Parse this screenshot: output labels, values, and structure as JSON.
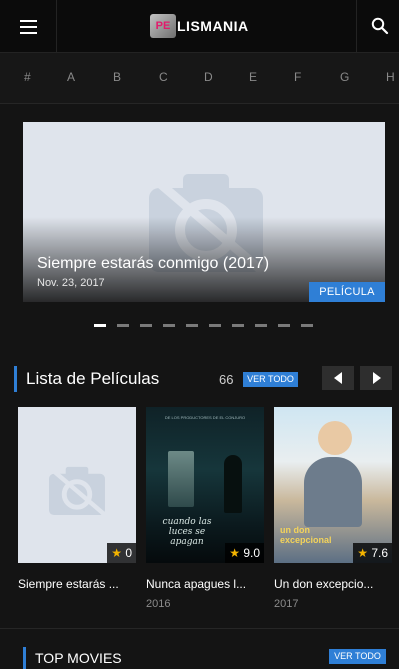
{
  "header": {
    "logo_mark": "PE",
    "logo_text": "LISMANIA",
    "menu_icon": "hamburger-menu-icon",
    "search_icon": "search-icon"
  },
  "alphabet": [
    "#",
    "A",
    "B",
    "C",
    "D",
    "E",
    "F",
    "G",
    "H"
  ],
  "slider": {
    "title": "Siempre estarás conmigo (2017)",
    "date": "Nov. 23, 2017",
    "badge": "PELÍCULA",
    "image_icon": "no-image-camera-icon",
    "dots_total": 10,
    "dots_active": 0
  },
  "movies_section": {
    "title": "Lista de Películas",
    "count": "66",
    "see_all": "VER TODO",
    "prev_icon": "chevron-left-icon",
    "next_icon": "chevron-right-icon"
  },
  "movies": [
    {
      "title": "Siempre estarás ...",
      "year": "",
      "rating": "0",
      "poster": "no-image"
    },
    {
      "title": "Nunca apagues l...",
      "year": "2016",
      "rating": "9.0",
      "poster": "dark-poster",
      "poster_text": "cuando las luces se apagan",
      "poster_top": "DE LOS PRODUCTORES DE EL CONJURO"
    },
    {
      "title": "Un don excepcio...",
      "year": "2017",
      "rating": "7.6",
      "poster": "bright-poster",
      "poster_text": "un don excepcional"
    }
  ],
  "top_section": {
    "title": "TOP MOVIES",
    "see_all": "VER TODO"
  },
  "colors": {
    "accent": "#2f7fd6",
    "background": "#141414",
    "header": "#0b0b0b",
    "star": "#f4b400"
  }
}
